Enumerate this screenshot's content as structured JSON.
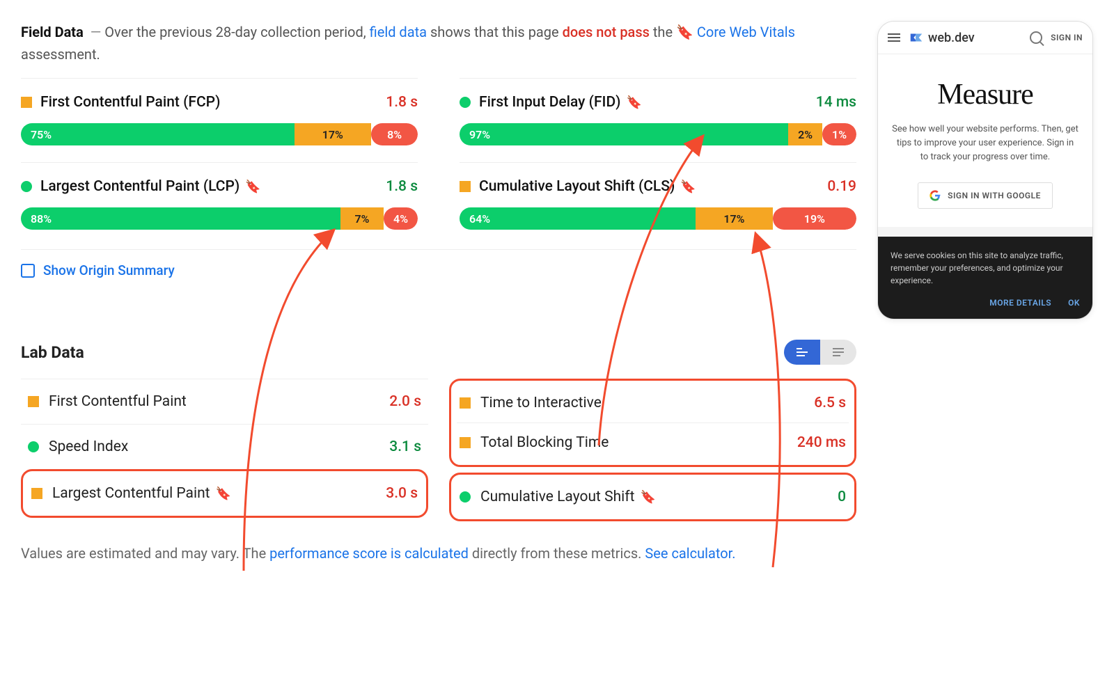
{
  "intro": {
    "title": "Field Data",
    "dash": "—",
    "text1": "Over the previous 28-day collection period,",
    "link1": "field data",
    "text2": "shows that this page",
    "fail": "does not pass",
    "text3": "the",
    "link2": "Core Web Vitals",
    "text4": "assessment."
  },
  "metrics": [
    {
      "name": "First Contentful Paint (FCP)",
      "bookmark": false,
      "shape": "sq",
      "color": "orange",
      "value": "1.8 s",
      "valcls": "vred",
      "dist": [
        {
          "c": "g",
          "v": "75%"
        },
        {
          "c": "o",
          "v": "17%"
        },
        {
          "c": "r",
          "v": "8%"
        }
      ]
    },
    {
      "name": "First Input Delay (FID)",
      "bookmark": true,
      "shape": "ci",
      "color": "green",
      "value": "14 ms",
      "valcls": "vgreen",
      "dist": [
        {
          "c": "g",
          "v": "97%"
        },
        {
          "c": "o",
          "v": "2%"
        },
        {
          "c": "r",
          "v": "1%"
        }
      ]
    },
    {
      "name": "Largest Contentful Paint (LCP)",
      "bookmark": true,
      "shape": "ci",
      "color": "green",
      "value": "1.8 s",
      "valcls": "vgreen",
      "dist": [
        {
          "c": "g",
          "v": "88%"
        },
        {
          "c": "o",
          "v": "7%"
        },
        {
          "c": "r",
          "v": "4%"
        }
      ]
    },
    {
      "name": "Cumulative Layout Shift (CLS)",
      "bookmark": true,
      "shape": "sq",
      "color": "orange",
      "value": "0.19",
      "valcls": "vred",
      "dist": [
        {
          "c": "g",
          "v": "64%"
        },
        {
          "c": "o",
          "v": "17%"
        },
        {
          "c": "r",
          "v": "19%"
        }
      ]
    }
  ],
  "origin_label": "Show Origin Summary",
  "labhead": "Lab Data",
  "lab_left": [
    {
      "name": "First Contentful Paint",
      "shape": "sq",
      "color": "orange",
      "value": "2.0 s",
      "valcls": "vred",
      "bookmark": false
    },
    {
      "name": "Speed Index",
      "shape": "ci",
      "color": "green",
      "value": "3.1 s",
      "valcls": "vgreen",
      "bookmark": false
    }
  ],
  "lab_left_boxed": [
    {
      "name": "Largest Contentful Paint",
      "shape": "sq",
      "color": "orange",
      "value": "3.0 s",
      "valcls": "vred",
      "bookmark": true
    }
  ],
  "lab_right_boxed_top": [
    {
      "name": "Time to Interactive",
      "shape": "sq",
      "color": "orange",
      "value": "6.5 s",
      "valcls": "vred",
      "bookmark": false
    },
    {
      "name": "Total Blocking Time",
      "shape": "sq",
      "color": "orange",
      "value": "240 ms",
      "valcls": "vred",
      "bookmark": false
    }
  ],
  "lab_right_boxed_bot": [
    {
      "name": "Cumulative Layout Shift",
      "shape": "ci",
      "color": "green",
      "value": "0",
      "valcls": "vgreen",
      "bookmark": true
    }
  ],
  "footer": {
    "t1": "Values are estimated and may vary. The",
    "l1": "performance score is calculated",
    "t2": "directly from these metrics.",
    "l2": "See calculator."
  },
  "device": {
    "brand": "web.dev",
    "signin": "SIGN IN",
    "title": "Measure",
    "desc": "See how well your website performs. Then, get tips to improve your user experience. Sign in to track your progress over time.",
    "btn": "SIGN IN WITH GOOGLE",
    "cookie": "We serve cookies on this site to analyze traffic, remember your preferences, and optimize your experience.",
    "more": "MORE DETAILS",
    "ok": "OK"
  }
}
